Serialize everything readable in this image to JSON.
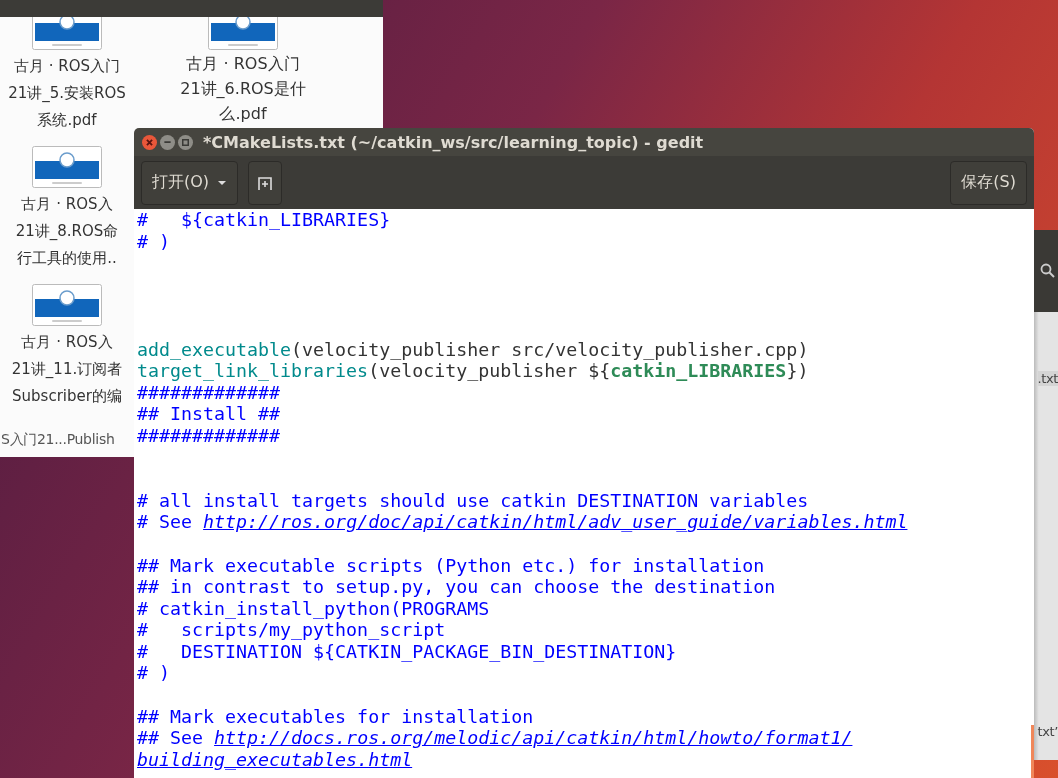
{
  "file_manager": {
    "items": [
      {
        "caption": [
          "古月 · ROS入门",
          "21讲_5.安装ROS",
          "系统.pdf"
        ]
      },
      {
        "caption": [
          "古月 · ROS入门",
          "21讲_6.ROS是什",
          "么.pdf"
        ]
      },
      {
        "caption": [
          "古月 · ROS入",
          "21讲_8.ROS命",
          "行工具的使用.."
        ]
      },
      {
        "caption": [
          "古月 · ROS入",
          "21讲_11.订阅者",
          "Subscriber的编"
        ]
      }
    ],
    "status_text": "S入门21...Publish"
  },
  "side_window": {
    "rows": [
      ".txt",
      "txt’"
    ]
  },
  "editor": {
    "title": "*CMakeLists.txt (~/catkin_ws/src/learning_topic) - gedit",
    "open_button": "打开(O)",
    "save_button": "保存(S)",
    "lines": [
      {
        "kind": "code",
        "segments": [
          {
            "kind": "comment",
            "text": "#   ${catkin_LIBRARIES}"
          }
        ]
      },
      {
        "kind": "code",
        "segments": [
          {
            "kind": "comment",
            "text": "# )"
          }
        ]
      },
      {
        "kind": "blank"
      },
      {
        "kind": "blank"
      },
      {
        "kind": "blank"
      },
      {
        "kind": "blank"
      },
      {
        "kind": "code",
        "segments": [
          {
            "kind": "command",
            "text": "add_executable"
          },
          {
            "kind": "plain",
            "text": "(velocity_publisher src/velocity_publisher.cpp)"
          }
        ]
      },
      {
        "kind": "code",
        "segments": [
          {
            "kind": "command",
            "text": "target_link_libraries"
          },
          {
            "kind": "plain",
            "text": "(velocity_publisher ${"
          },
          {
            "kind": "variable",
            "text": "catkin_LIBRARIES"
          },
          {
            "kind": "plain",
            "text": "})"
          }
        ]
      },
      {
        "kind": "code",
        "segments": [
          {
            "kind": "comment",
            "text": "#############"
          }
        ]
      },
      {
        "kind": "code",
        "segments": [
          {
            "kind": "comment",
            "text": "## Install ##"
          }
        ]
      },
      {
        "kind": "code",
        "segments": [
          {
            "kind": "comment",
            "text": "#############"
          }
        ]
      },
      {
        "kind": "blank"
      },
      {
        "kind": "blank"
      },
      {
        "kind": "code",
        "segments": [
          {
            "kind": "comment",
            "text": "# all install targets should use catkin DESTINATION variables"
          }
        ]
      },
      {
        "kind": "code",
        "segments": [
          {
            "kind": "comment",
            "text": "# See "
          },
          {
            "kind": "link",
            "text": "http://ros.org/doc/api/catkin/html/adv_user_guide/variables.html"
          }
        ]
      },
      {
        "kind": "blank"
      },
      {
        "kind": "code",
        "segments": [
          {
            "kind": "comment",
            "text": "## Mark executable scripts (Python etc.) for installation"
          }
        ]
      },
      {
        "kind": "code",
        "segments": [
          {
            "kind": "comment",
            "text": "## in contrast to setup.py, you can choose the destination"
          }
        ]
      },
      {
        "kind": "code",
        "segments": [
          {
            "kind": "comment",
            "text": "# catkin_install_python(PROGRAMS"
          }
        ]
      },
      {
        "kind": "code",
        "segments": [
          {
            "kind": "comment",
            "text": "#   scripts/my_python_script"
          }
        ]
      },
      {
        "kind": "code",
        "segments": [
          {
            "kind": "comment",
            "text": "#   DESTINATION ${CATKIN_PACKAGE_BIN_DESTINATION}"
          }
        ]
      },
      {
        "kind": "code",
        "segments": [
          {
            "kind": "comment",
            "text": "# )"
          }
        ]
      },
      {
        "kind": "blank"
      },
      {
        "kind": "code",
        "segments": [
          {
            "kind": "comment",
            "text": "## Mark executables for installation"
          }
        ]
      },
      {
        "kind": "code",
        "segments": [
          {
            "kind": "comment",
            "text": "## See "
          },
          {
            "kind": "link",
            "text": "http://docs.ros.org/melodic/api/catkin/html/howto/format1/"
          }
        ]
      },
      {
        "kind": "code",
        "segments": [
          {
            "kind": "link",
            "text": "building_executables.html"
          }
        ]
      }
    ]
  }
}
